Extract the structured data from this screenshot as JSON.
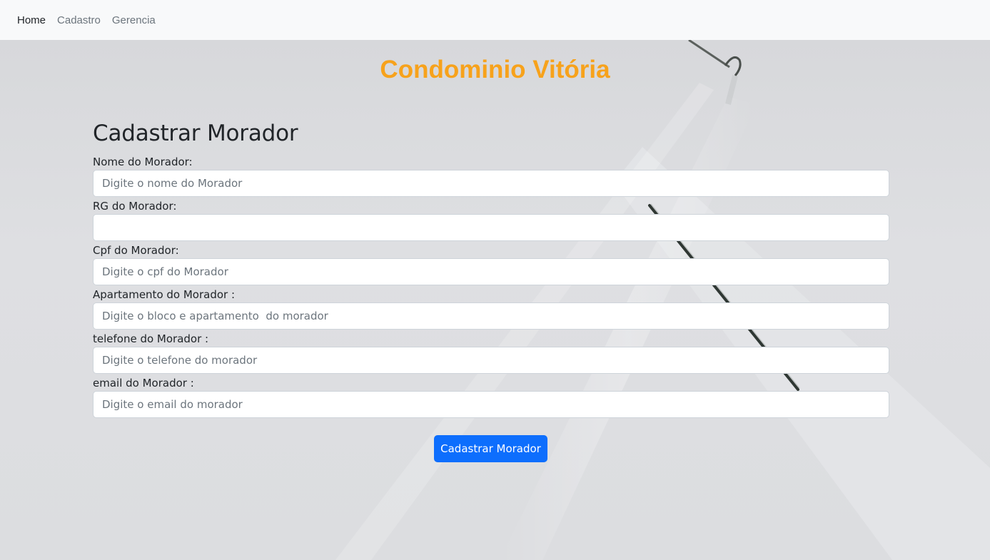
{
  "nav": {
    "items": [
      {
        "label": "Home",
        "active": true
      },
      {
        "label": "Cadastro",
        "active": false
      },
      {
        "label": "Gerencia",
        "active": false
      }
    ]
  },
  "header": {
    "brand": "Condominio Vitória",
    "brand_color": "#f7a21b"
  },
  "form": {
    "title": "Cadastrar Morador",
    "fields": [
      {
        "label": "Nome do Morador:",
        "placeholder": "Digite o nome do Morador",
        "value": ""
      },
      {
        "label": "RG do Morador:",
        "placeholder": "",
        "value": ""
      },
      {
        "label": "Cpf do Morador:",
        "placeholder": "Digite o cpf do Morador",
        "value": ""
      },
      {
        "label": "Apartamento do Morador :",
        "placeholder": "Digite o bloco e apartamento  do morador",
        "value": ""
      },
      {
        "label": "telefone do Morador :",
        "placeholder": "Digite o telefone do morador",
        "value": ""
      },
      {
        "label": "email do Morador :",
        "placeholder": "Digite o email do morador",
        "value": ""
      }
    ],
    "submit_label": "Cadastrar Morador",
    "submit_color": "#0d6efd"
  }
}
